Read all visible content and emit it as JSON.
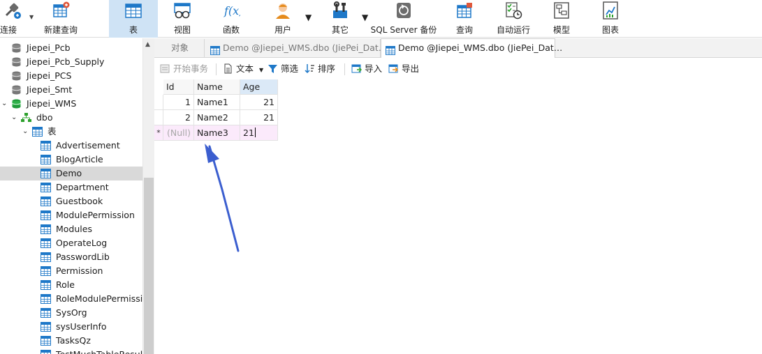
{
  "ribbon": {
    "connect": "连接",
    "new_query": "新建查询",
    "table": "表",
    "view": "视图",
    "function": "函数",
    "user": "用户",
    "other": "其它",
    "backup": "SQL Server 备份",
    "query": "查询",
    "automation": "自动运行",
    "model": "模型",
    "chart": "图表"
  },
  "tree": {
    "items": [
      {
        "label": "Jiepei_Pcb"
      },
      {
        "label": "Jiepei_Pcb_Supply"
      },
      {
        "label": "Jiepei_PCS"
      },
      {
        "label": "Jiepei_Smt"
      },
      {
        "label": "Jiepei_WMS"
      },
      {
        "label": "dbo"
      },
      {
        "label": "表"
      },
      {
        "label": "Advertisement"
      },
      {
        "label": "BlogArticle"
      },
      {
        "label": "Demo"
      },
      {
        "label": "Department"
      },
      {
        "label": "Guestbook"
      },
      {
        "label": "ModulePermission"
      },
      {
        "label": "Modules"
      },
      {
        "label": "OperateLog"
      },
      {
        "label": "PasswordLib"
      },
      {
        "label": "Permission"
      },
      {
        "label": "Role"
      },
      {
        "label": "RoleModulePermissic"
      },
      {
        "label": "SysOrg"
      },
      {
        "label": "sysUserInfo"
      },
      {
        "label": "TasksQz"
      },
      {
        "label": "TestMuchTableResult"
      }
    ]
  },
  "tabs": {
    "objects": "对象",
    "tab1": "Demo @Jiepei_WMS.dbo (JiePei_Dat…",
    "tab2": "Demo @Jiepei_WMS.dbo (JiePei_Dat…"
  },
  "toolbar": {
    "begin_transaction": "开始事务",
    "text": "文本",
    "filter": "筛选",
    "sort": "排序",
    "import": "导入",
    "export": "导出"
  },
  "grid": {
    "columns": [
      "Id",
      "Name",
      "Age"
    ],
    "rows": [
      {
        "id": "1",
        "name": "Name1",
        "age": "21"
      },
      {
        "id": "2",
        "name": "Name2",
        "age": "21"
      },
      {
        "marker": "*",
        "id": "(Null)",
        "name": "Name3",
        "age": "21"
      }
    ]
  },
  "colors": {
    "accent": "#1e78c8",
    "selected_tab": "#cfe3f5",
    "arrow": "#3b5ecf",
    "new_row": "#fbeafb"
  }
}
